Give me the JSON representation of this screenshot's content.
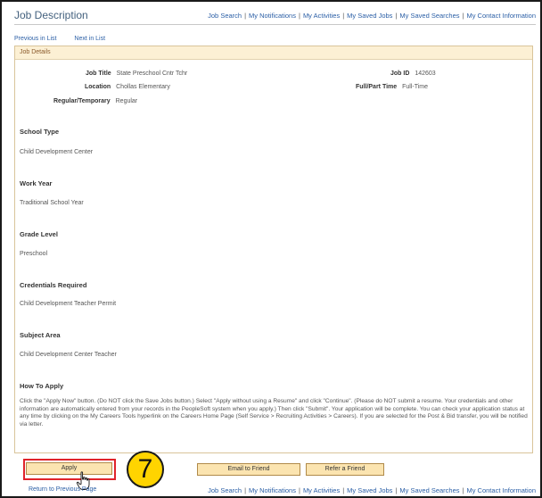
{
  "header": {
    "title": "Job Description",
    "links": [
      "Job Search",
      "My Notifications",
      "My Activities",
      "My Saved Jobs",
      "My Saved Searches",
      "My Contact Information"
    ]
  },
  "nav": {
    "previous": "Previous in List",
    "next": "Next in List"
  },
  "details": {
    "heading": "Job Details",
    "job_title_label": "Job Title",
    "job_title": "State Preschool Cntr Tchr",
    "location_label": "Location",
    "location": "Chollas Elementary",
    "regular_temp_label": "Regular/Temporary",
    "regular_temp": "Regular",
    "job_id_label": "Job ID",
    "job_id": "142603",
    "full_part_label": "Full/Part Time",
    "full_part": "Full-Time"
  },
  "sections": [
    {
      "title": "School Type",
      "value": "Child Development Center"
    },
    {
      "title": "Work Year",
      "value": "Traditional School Year"
    },
    {
      "title": "Grade Level",
      "value": "Preschool"
    },
    {
      "title": "Credentials Required",
      "value": "Child Development Teacher Permit"
    },
    {
      "title": "Subject Area",
      "value": "Child Development Center Teacher"
    }
  ],
  "how_to_apply": {
    "title": "How To Apply",
    "text": "Click the \"Apply Now\" button. (Do NOT click the Save Jobs button.) Select \"Apply without using a Resume\" and click \"Continue\". (Please do NOT submit a resume. Your credentials and other information are automatically entered from your records in the PeopleSoft system when you apply.) Then click \"Submit\". Your application will be complete. You can check your application status at any time by clicking on the My Careers Tools hyperlink on the Careers Home Page (Self Service > Recruiting Activities > Careers). If you are selected for the Post & Bid transfer, you will be notified via letter."
  },
  "buttons": {
    "apply": "Apply",
    "email": "Email to Friend",
    "refer": "Refer a Friend"
  },
  "step_badge": "7",
  "footer": {
    "return_link": "Return to Previous Page",
    "links": [
      "Job Search",
      "My Notifications",
      "My Activities",
      "My Saved Jobs",
      "My Saved Searches",
      "My Contact Information"
    ]
  },
  "colors": {
    "link": "#2b5fa6",
    "panel_head_bg": "#fcf0d4",
    "button_bg": "#fbe4b0",
    "highlight": "#e0232a",
    "badge": "#ffd400"
  }
}
